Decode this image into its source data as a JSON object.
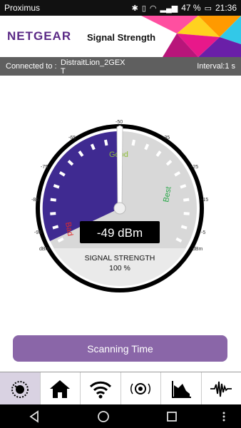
{
  "status_bar": {
    "carrier": "Proximus",
    "battery": "47 %",
    "time": "21:36"
  },
  "header": {
    "logo": "NETGEAR",
    "title": "Signal Strength"
  },
  "connection": {
    "label": "Connected to :",
    "ssid": "DistraitLion_2GEX\nT",
    "interval": "Interval:1 s"
  },
  "gauge": {
    "scale_labels": [
      "dBm",
      "-95",
      "-85",
      "-75",
      "-65",
      "-50",
      "-35",
      "-25",
      "-15",
      "-5",
      "dBm"
    ],
    "zone_labels": {
      "good": "Good",
      "bad": "Bad",
      "best": "Best"
    },
    "reading": "-49 dBm",
    "caption": "SIGNAL STRENGTH",
    "percent": "100 %",
    "value_dbm": -49
  },
  "scan_button": {
    "label": "Scanning Time"
  },
  "tabs": [
    {
      "name": "tab-signal-meter",
      "icon": "gauge-icon",
      "active": true
    },
    {
      "name": "tab-home",
      "icon": "home-icon",
      "active": false
    },
    {
      "name": "tab-wifi",
      "icon": "wifi-icon",
      "active": false
    },
    {
      "name": "tab-speaker",
      "icon": "speaker-icon",
      "active": false
    },
    {
      "name": "tab-chart",
      "icon": "chart-icon",
      "active": false
    },
    {
      "name": "tab-waveform",
      "icon": "waveform-icon",
      "active": false
    }
  ],
  "colors": {
    "accent": "#3f2a91",
    "button": "#8a66a8",
    "header_bar": "#5f5f5f"
  }
}
